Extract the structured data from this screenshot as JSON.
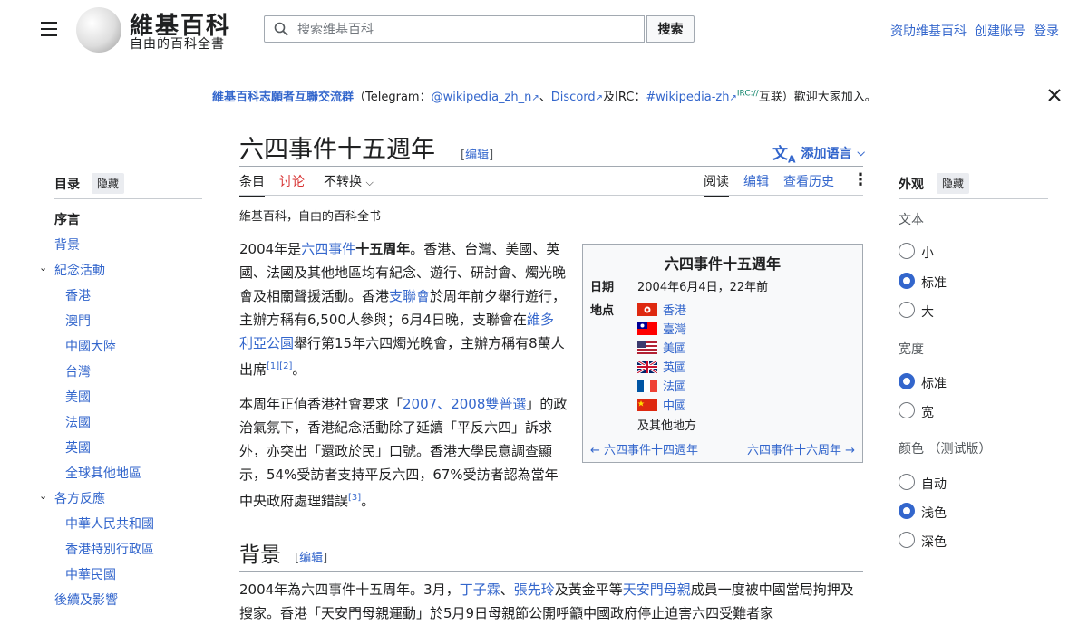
{
  "header": {
    "logo_title": "維基百科",
    "logo_subtitle": "自由的百科全書",
    "search_placeholder": "搜索维基百科",
    "search_button": "搜索",
    "user_links": [
      "资助维基百科",
      "创建账号",
      "登录"
    ]
  },
  "banner": {
    "link": "維基百科志願者互聯交流群",
    "p1": "（Telegram：",
    "telegram": "@wikipedia_zh_n",
    "p2": "、",
    "discord": "Discord",
    "p3": "及IRC：",
    "irc": "#wikipedia-zh",
    "irc_sup": "IRC://",
    "p4": "互联）歡迎大家加入。"
  },
  "article": {
    "title": "六四事件十五週年",
    "edit_label": "[编辑]",
    "add_language": "添加语言",
    "tabs": {
      "article": "条目",
      "talk": "讨论",
      "variant": "不转换",
      "read": "阅读",
      "edit": "编辑",
      "history": "查看历史"
    },
    "tagline": "維基百科，自由的百科全书",
    "para1": {
      "t1": "2004年是",
      "l1": "六四事件",
      "b1": "十五周年",
      "t2": "。香港、台灣、美國、英國、法國及其他地區均有紀念、遊行、研討會、燭光晚會及相關聲援活動。香港",
      "l2": "支聯會",
      "t3": "於周年前夕舉行遊行，主辦方稱有6,500人參與；6月4日晚，支聯會在",
      "l3": "維多利亞公園",
      "t4": "舉行第15年六四燭光晚會，主辦方稱有8萬人出席",
      "ref": "[1][2]",
      "t5": "。"
    },
    "para2": {
      "t1": "本周年正值香港社會要求「",
      "l1": "2007、2008雙普選",
      "t2": "」的政治氣氛下，香港紀念活動除了延續「平反六四」訴求外，亦突出「還政於民」口號。香港大學民意調查顯示，54%受訪者支持平反六四，67%受訪者認為當年中央政府處理錯誤",
      "ref": "[3]",
      "t3": "。"
    },
    "section_background": "背景",
    "para3": {
      "t1": "2004年為六四事件十五周年。3月，",
      "l1": "丁子霖",
      "t2": "、",
      "l2": "張先玲",
      "t3": "及黃金平等",
      "l3": "天安門母親",
      "t4": "成員一度被中國當局拘押及搜家。香港「天安門母親運動」於5月9日母親節公開呼籲中國政府停止迫害六四受難者家"
    }
  },
  "infobox": {
    "title": "六四事件十五週年",
    "date_label": "日期",
    "date_value": "2004年6月4日，22年前",
    "place_label": "地点",
    "locations": [
      "香港",
      "臺灣",
      "美國",
      "英國",
      "法國",
      "中國"
    ],
    "other": "及其他地方",
    "prev": "← 六四事件十四週年",
    "next": "六四事件十六周年 →"
  },
  "toc": {
    "title": "目录",
    "hide": "隐藏",
    "items": [
      "序言",
      "背景",
      "紀念活動",
      "香港",
      "澳門",
      "中國大陸",
      "台灣",
      "美國",
      "法國",
      "英國",
      "全球其他地區",
      "各方反應",
      "中華人民共和國",
      "香港特別行政區",
      "中華民國",
      "後續及影響"
    ]
  },
  "appearance": {
    "title": "外观",
    "hide": "隐藏",
    "text_label": "文本",
    "text_options": [
      "小",
      "标准",
      "大"
    ],
    "text_selected": "标准",
    "width_label": "宽度",
    "width_options": [
      "标准",
      "宽"
    ],
    "width_selected": "标准",
    "color_label": "颜色 （测试版）",
    "color_options": [
      "自动",
      "浅色",
      "深色"
    ],
    "color_selected": "浅色"
  },
  "colors": {
    "link": "#3366cc",
    "talk_link": "#d73333",
    "radio_on": "#3366cc"
  }
}
